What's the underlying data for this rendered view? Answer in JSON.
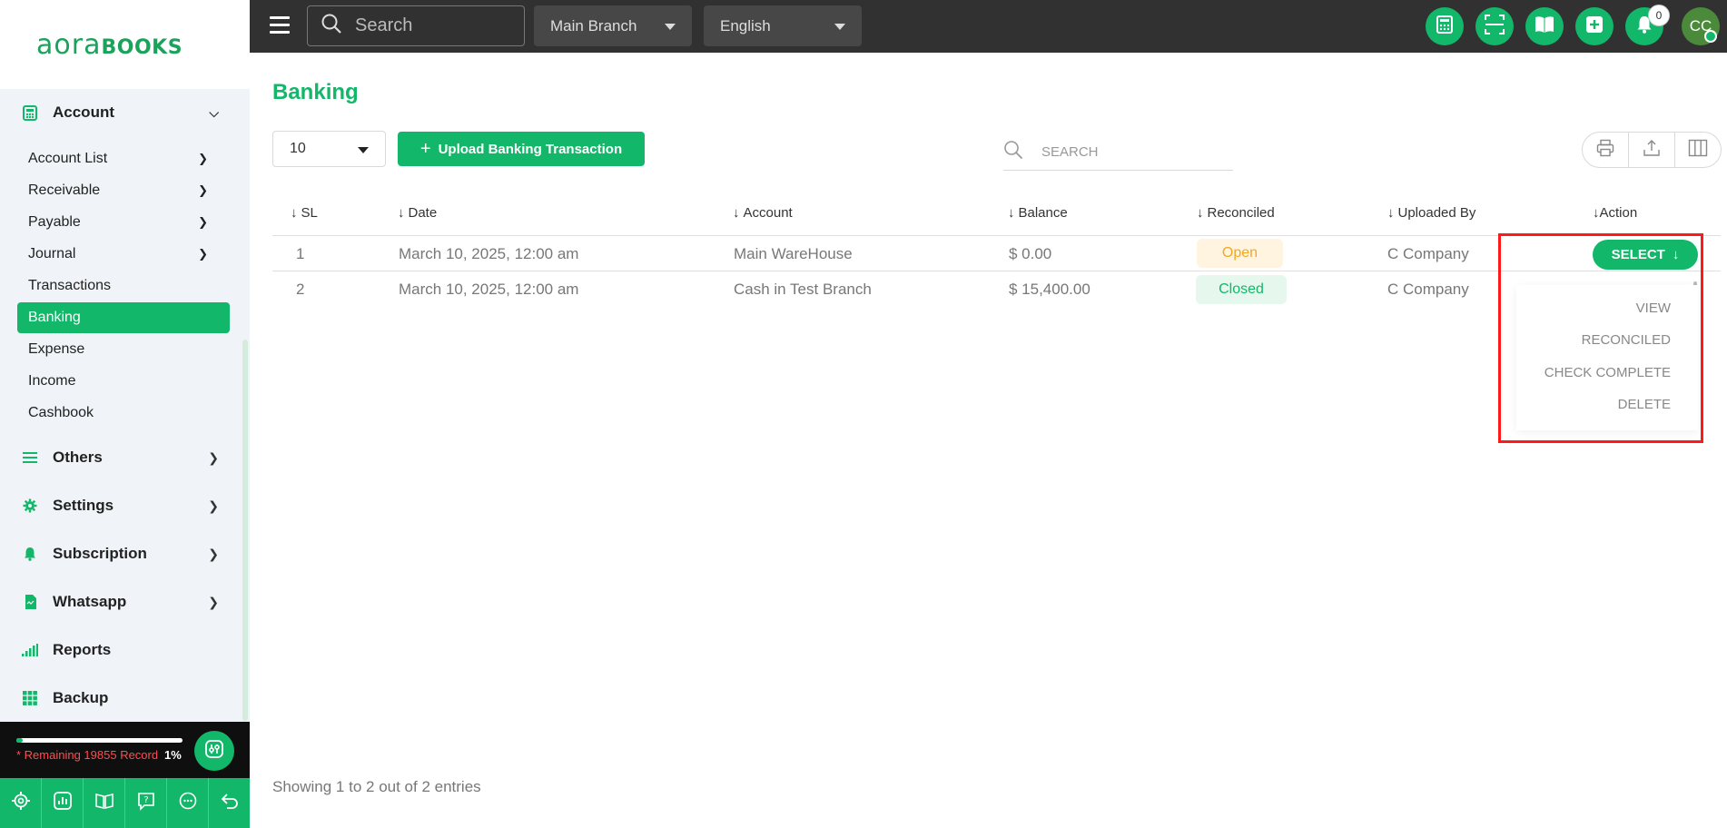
{
  "sidebar": {
    "logo": {
      "main": "aora",
      "accent": "BOOKS"
    },
    "sections": [
      {
        "label": "Account",
        "icon": "calculator-icon"
      },
      {
        "label": "Others",
        "icon": "list-icon"
      },
      {
        "label": "Settings",
        "icon": "gear-icon"
      },
      {
        "label": "Subscription",
        "icon": "bell-icon"
      },
      {
        "label": "Whatsapp",
        "icon": "document-icon"
      },
      {
        "label": "Reports",
        "icon": "bar-chart-icon"
      },
      {
        "label": "Backup",
        "icon": "grid-icon"
      }
    ],
    "account_items": [
      {
        "label": "Account List"
      },
      {
        "label": "Receivable"
      },
      {
        "label": "Payable"
      },
      {
        "label": "Journal"
      },
      {
        "label": "Transactions"
      },
      {
        "label": "Banking"
      },
      {
        "label": "Expense"
      },
      {
        "label": "Income"
      },
      {
        "label": "Cashbook"
      }
    ],
    "quota": {
      "text": "* Remaining 19855 Record",
      "percent": "1%",
      "fraction": 0.01
    }
  },
  "topbar": {
    "search_placeholder": "Search",
    "branch": "Main Branch",
    "language": "English",
    "notifications": "0",
    "avatar": "CC"
  },
  "main": {
    "title": "Banking",
    "page_size": "10",
    "upload_label": "Upload Banking Transaction",
    "search_placeholder": "SEARCH",
    "columns": [
      "SL",
      "Date",
      "Account",
      "Balance",
      "Reconciled",
      "Uploaded By",
      "Action"
    ],
    "rows": [
      {
        "sl": "1",
        "date": "March 10, 2025, 12:00 am",
        "account": "Main WareHouse",
        "balance": "$ 0.00",
        "reconciled": "Open",
        "uploaded_by": "C Company"
      },
      {
        "sl": "2",
        "date": "March 10, 2025, 12:00 am",
        "account": "Cash in Test Branch",
        "balance": "$ 15,400.00",
        "reconciled": "Closed",
        "uploaded_by": "C Company"
      }
    ],
    "action_button": "SELECT",
    "action_menu": [
      "VIEW",
      "RECONCILED",
      "CHECK COMPLETE",
      "DELETE"
    ],
    "footer": "Showing 1 to 2 out of 2 entries"
  },
  "colors": {
    "brand": "#12b76a",
    "topbar": "#313131",
    "open": "#f5a623",
    "highlight": "#ff1a1a"
  }
}
